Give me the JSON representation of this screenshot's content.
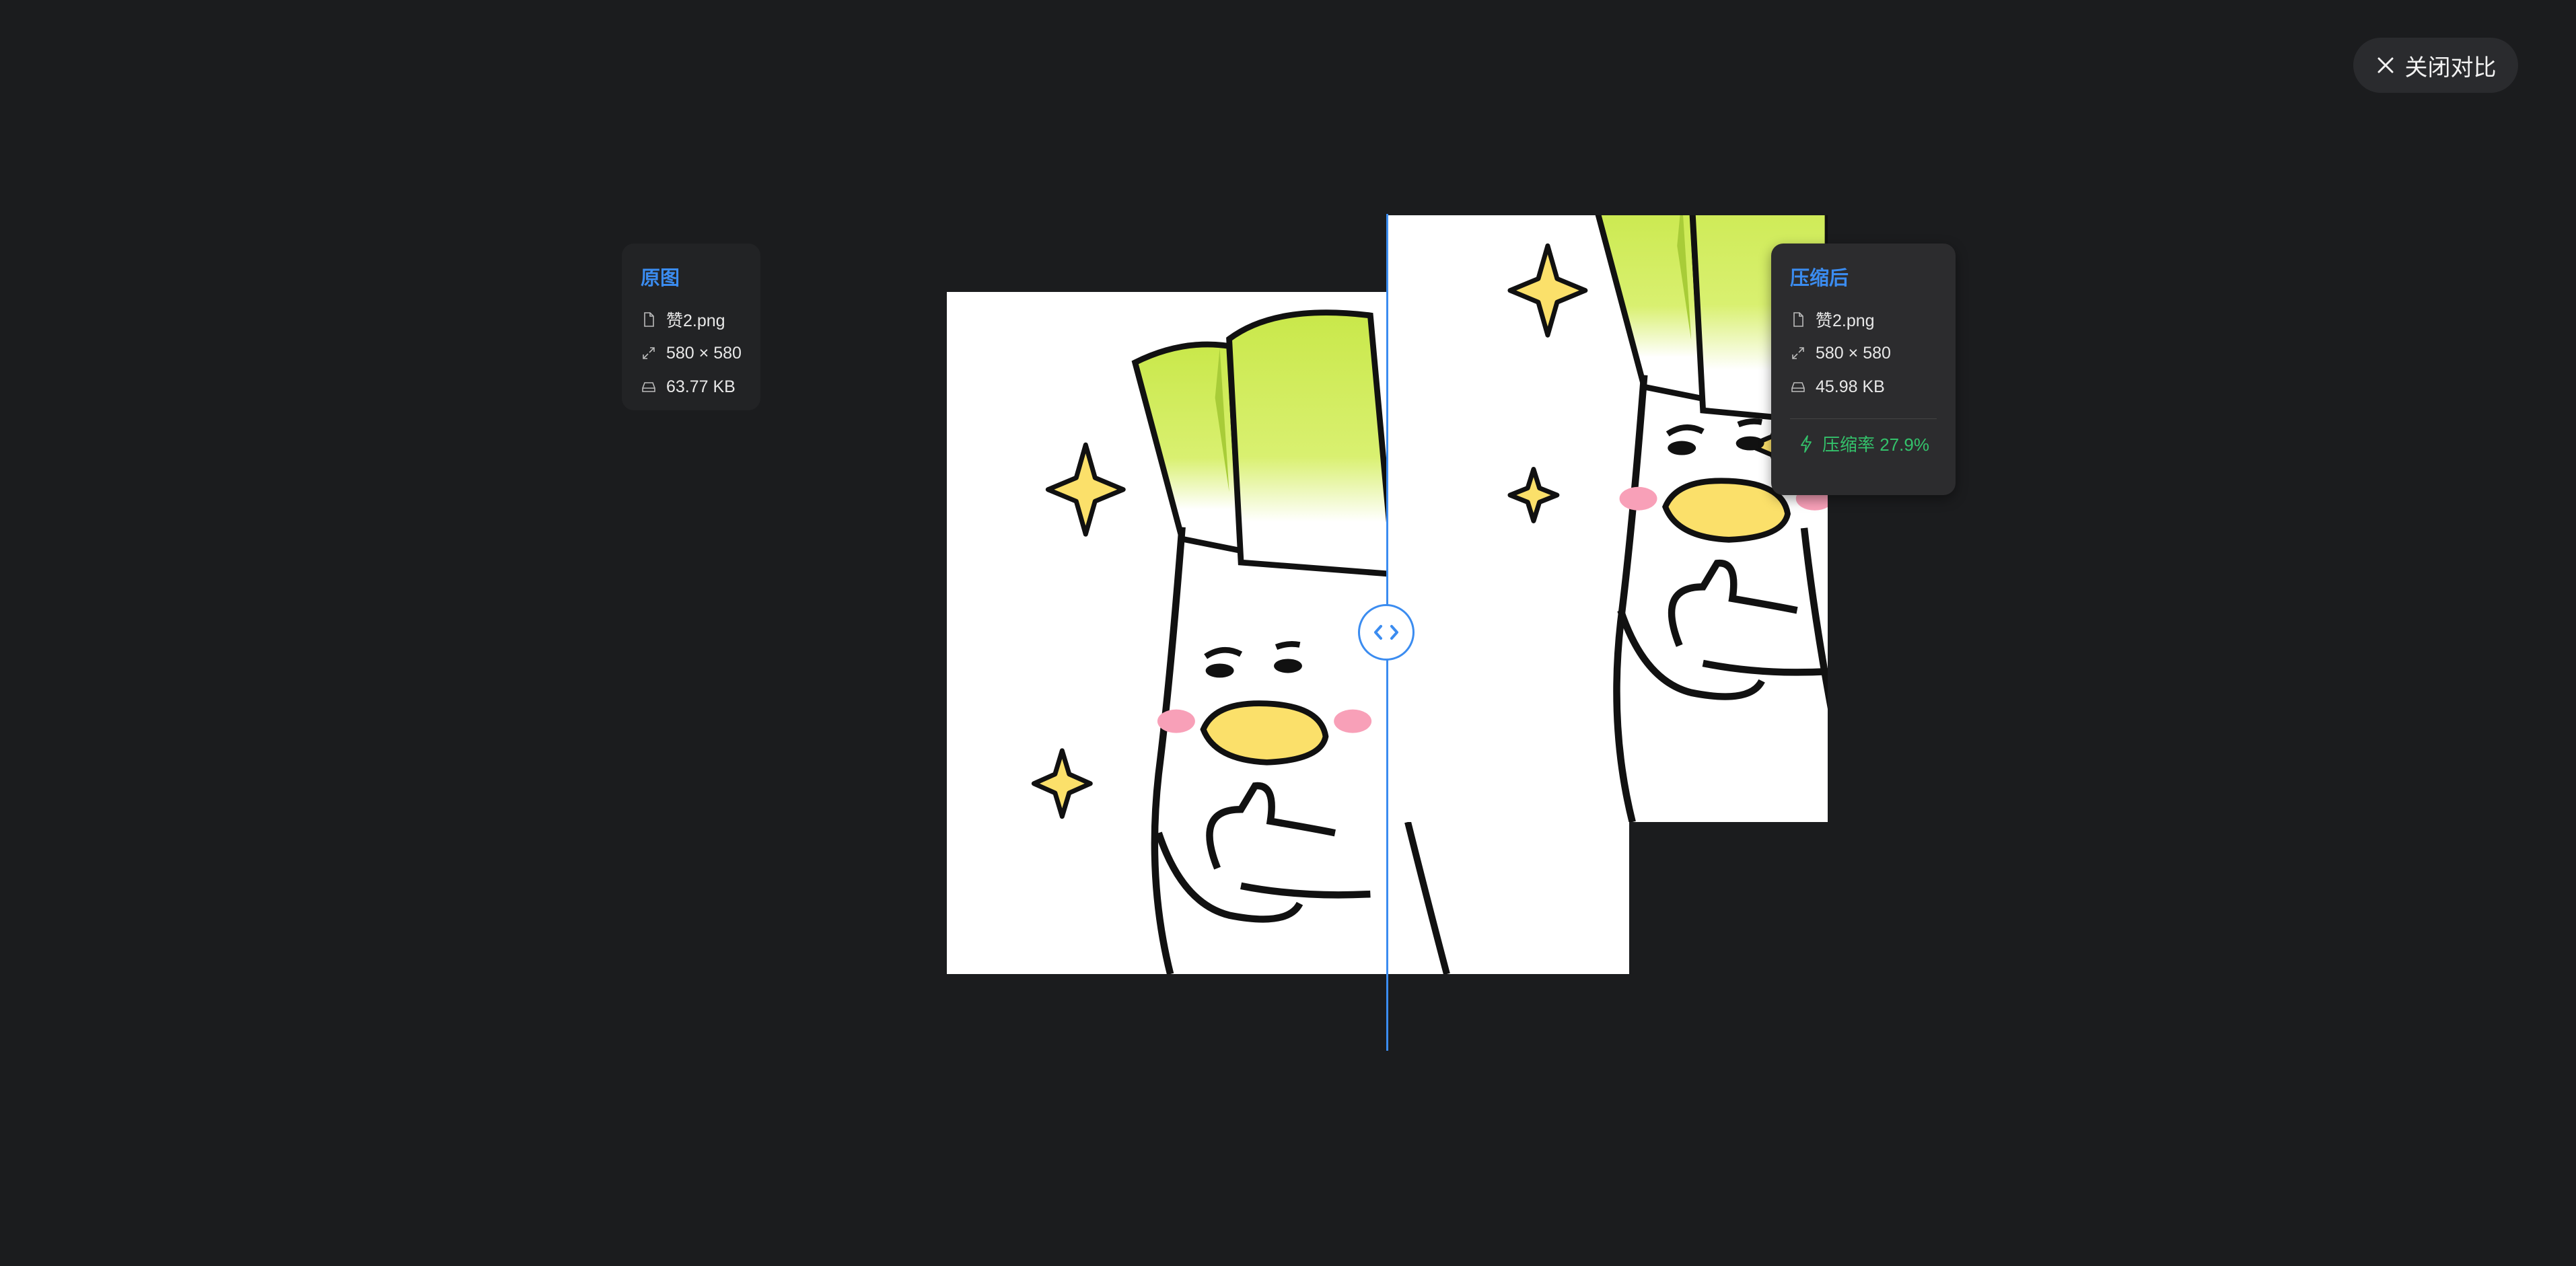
{
  "close_button": {
    "label": "关闭对比",
    "icon": "close-icon"
  },
  "original": {
    "title": "原图",
    "filename": "赞2.png",
    "dimensions": "580 × 580",
    "size": "63.77 KB"
  },
  "compressed": {
    "title": "压缩后",
    "filename": "赞2.png",
    "dimensions": "580 × 580",
    "size": "45.98 KB",
    "ratio": "压缩率 27.9%"
  },
  "colors": {
    "background": "#1b1c1e",
    "accent": "#3b8cf0",
    "success": "#34c26b"
  }
}
